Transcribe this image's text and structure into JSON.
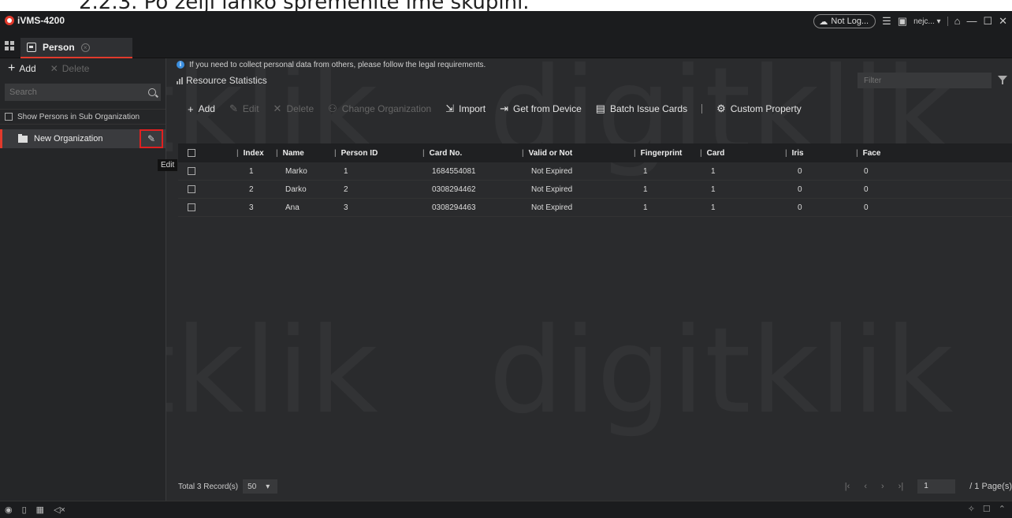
{
  "document_heading": "2.2.3. Po želji lahko spremenite ime skupini.",
  "app": {
    "title": "iVMS-4200",
    "cloud_status": "Not Log...",
    "user": "nejc...",
    "tab": "Person"
  },
  "sidebar": {
    "add_label": "Add",
    "delete_label": "Delete",
    "search_placeholder": "Search",
    "show_sub_label": "Show Persons in Sub Organization",
    "org_name": "New Organization",
    "edit_tooltip": "Edit"
  },
  "main": {
    "notice": "If you need to collect personal data from others, please follow the legal requirements.",
    "resource_stats": "Resource Statistics",
    "filter_placeholder": "Filter",
    "toolbar": {
      "add": "Add",
      "edit": "Edit",
      "delete": "Delete",
      "change_org": "Change Organization",
      "import": "Import",
      "get_from_device": "Get from Device",
      "batch_issue_cards": "Batch Issue Cards",
      "custom_property": "Custom Property"
    },
    "table": {
      "headers": [
        "Index",
        "Name",
        "Person ID",
        "Card No.",
        "Valid or Not",
        "Fingerprint",
        "Card",
        "Iris",
        "Face"
      ],
      "rows": [
        [
          "1",
          "Marko",
          "1",
          "1684554081",
          "Not Expired",
          "1",
          "1",
          "0",
          "0"
        ],
        [
          "2",
          "Darko",
          "2",
          "0308294462",
          "Not Expired",
          "1",
          "1",
          "0",
          "0"
        ],
        [
          "3",
          "Ana",
          "3",
          "0308294463",
          "Not Expired",
          "1",
          "1",
          "0",
          "0"
        ]
      ]
    },
    "footer": {
      "total": "Total 3 Record(s)",
      "page_size": "50",
      "page_current": "1",
      "page_total": "/ 1 Page(s)"
    }
  },
  "watermark": "digitklik",
  "colors": {
    "accent": "#e23a2c",
    "background": "#2a2b2d",
    "highlight_box": "#e02020"
  }
}
